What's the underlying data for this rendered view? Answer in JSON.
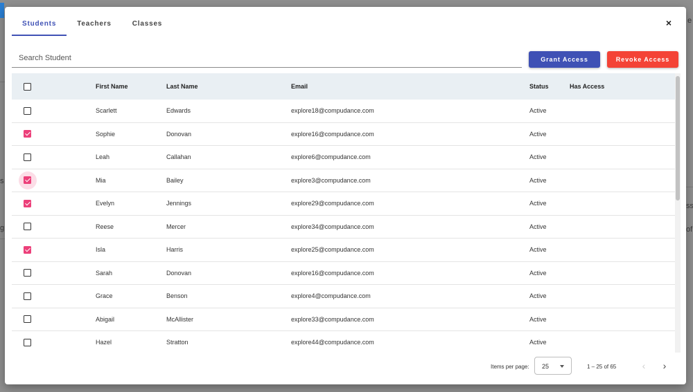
{
  "background": {
    "frag_e": "e",
    "frag_s": "s",
    "frag_g": "g",
    "frag_ss": "ss",
    "frag_of": "of"
  },
  "modal": {
    "close_icon": "×",
    "tabs": [
      {
        "label": "Students",
        "active": true
      },
      {
        "label": "Teachers",
        "active": false
      },
      {
        "label": "Classes",
        "active": false
      }
    ],
    "search": {
      "placeholder": "Search Student",
      "value": ""
    },
    "grant_label": "Grant Access",
    "revoke_label": "Revoke Access",
    "colors": {
      "accent": "#3f51b5",
      "danger": "#f44336",
      "checkbox": "#ec407a",
      "header_bg": "#e9eff3"
    }
  },
  "table": {
    "headers": {
      "first": "First Name",
      "last": "Last Name",
      "email": "Email",
      "status": "Status",
      "access": "Has Access"
    },
    "rows": [
      {
        "checked": false,
        "first": "Scarlett",
        "last": "Edwards",
        "email": "explore18@compudance.com",
        "status": "Active",
        "access": ""
      },
      {
        "checked": true,
        "first": "Sophie",
        "last": "Donovan",
        "email": "explore16@compudance.com",
        "status": "Active",
        "access": ""
      },
      {
        "checked": false,
        "first": "Leah",
        "last": "Callahan",
        "email": "explore6@compudance.com",
        "status": "Active",
        "access": ""
      },
      {
        "checked": true,
        "focused": true,
        "first": "Mia",
        "last": "Bailey",
        "email": "explore3@compudance.com",
        "status": "Active",
        "access": ""
      },
      {
        "checked": true,
        "first": "Evelyn",
        "last": "Jennings",
        "email": "explore29@compudance.com",
        "status": "Active",
        "access": ""
      },
      {
        "checked": false,
        "first": "Reese",
        "last": "Mercer",
        "email": "explore34@compudance.com",
        "status": "Active",
        "access": ""
      },
      {
        "checked": true,
        "first": "Isla",
        "last": "Harris",
        "email": "explore25@compudance.com",
        "status": "Active",
        "access": ""
      },
      {
        "checked": false,
        "first": "Sarah",
        "last": "Donovan",
        "email": "explore16@compudance.com",
        "status": "Active",
        "access": ""
      },
      {
        "checked": false,
        "first": "Grace",
        "last": "Benson",
        "email": "explore4@compudance.com",
        "status": "Active",
        "access": ""
      },
      {
        "checked": false,
        "first": "Abigail",
        "last": "McAllister",
        "email": "explore33@compudance.com",
        "status": "Active",
        "access": ""
      },
      {
        "checked": false,
        "first": "Hazel",
        "last": "Stratton",
        "email": "explore44@compudance.com",
        "status": "Active",
        "access": ""
      }
    ]
  },
  "paginator": {
    "items_per_page_label": "Items per page:",
    "items_per_page_value": "25",
    "range_label": "1 – 25 of 65",
    "prev_icon": "‹",
    "next_icon": "›"
  }
}
